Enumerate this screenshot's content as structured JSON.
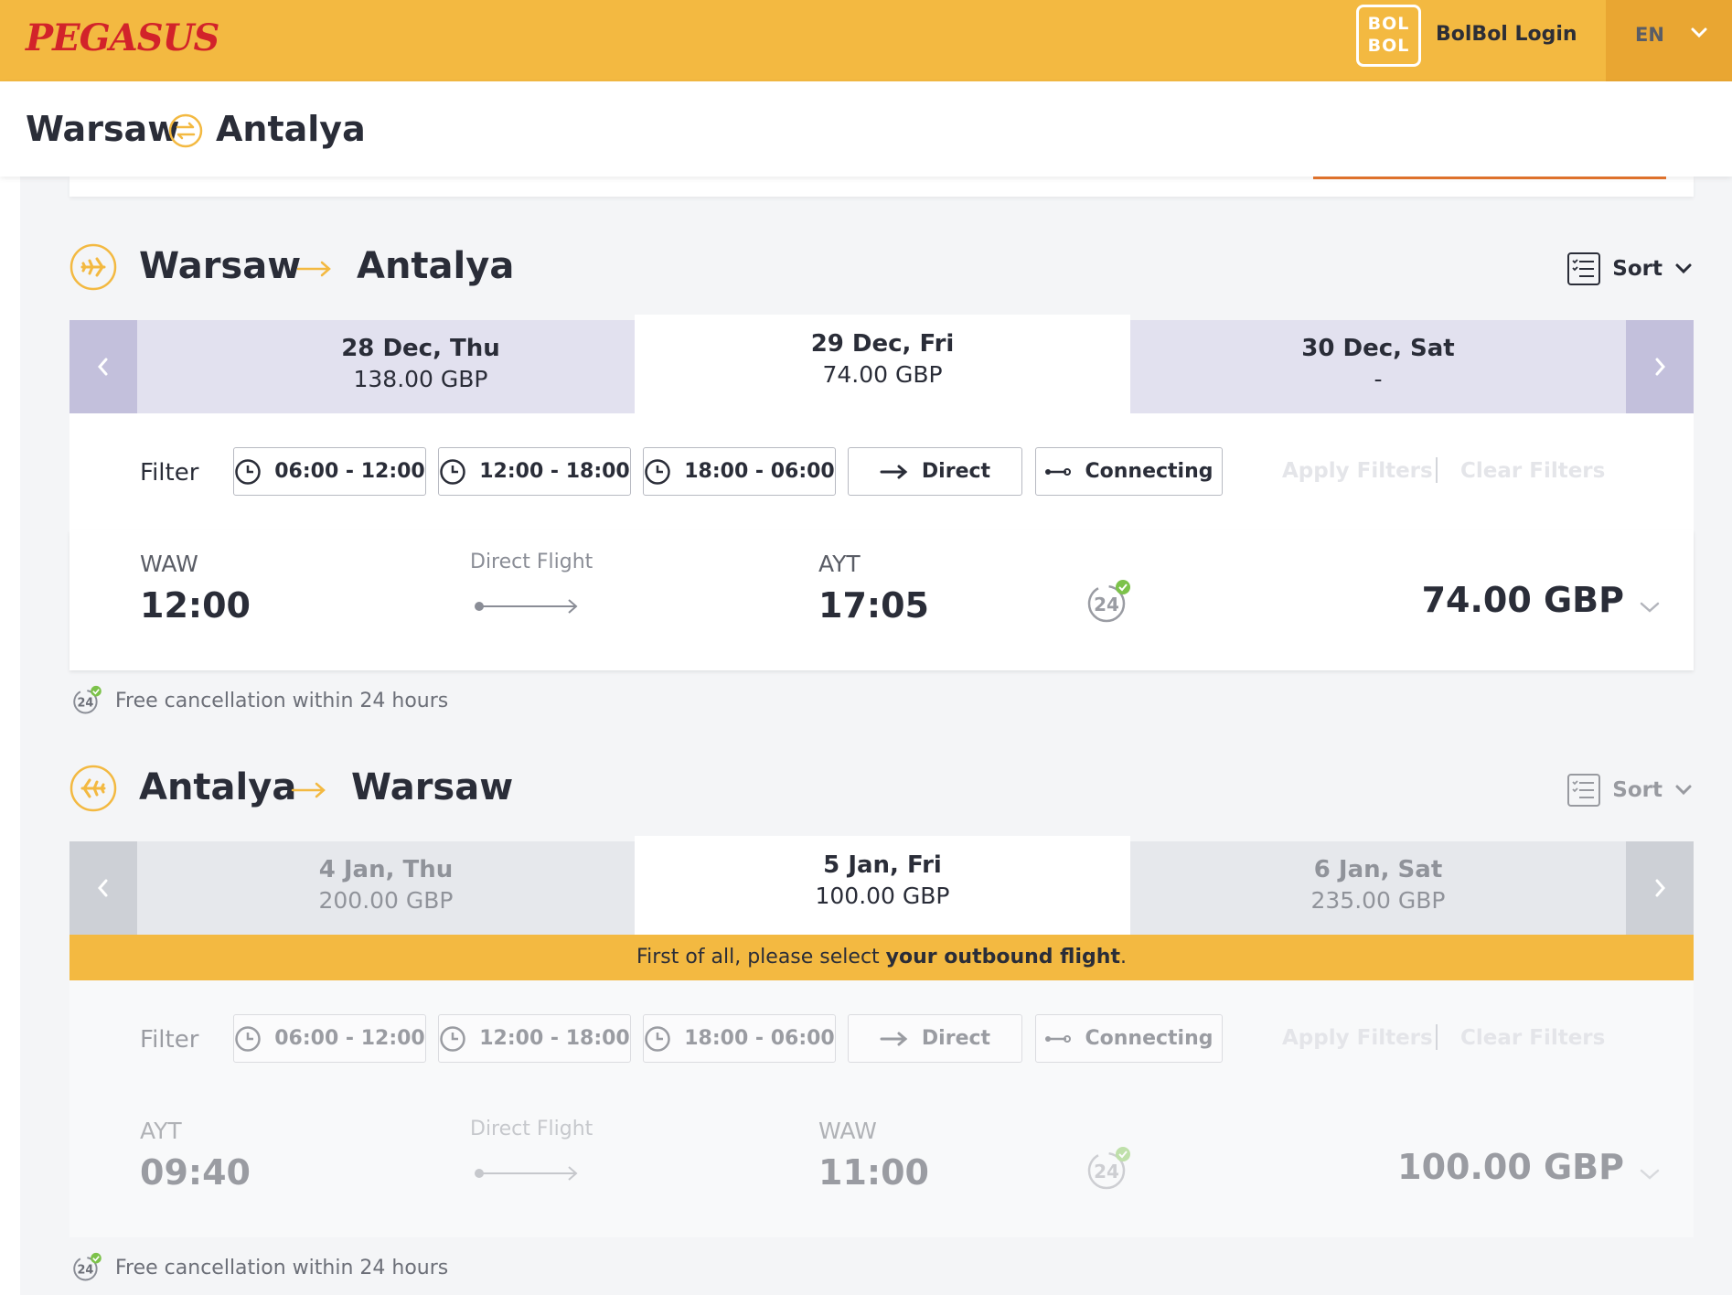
{
  "header": {
    "logo": "PEGASUS",
    "bolbol_badge_line1": "BOL",
    "bolbol_badge_line2": "BOL",
    "bolbol_login": "BolBol Login",
    "language": "EN"
  },
  "route": {
    "from": "Warsaw",
    "to": "Antalya"
  },
  "outbound": {
    "from": "Warsaw",
    "to": "Antalya",
    "sort_label": "Sort",
    "dates": [
      {
        "date": "28 Dec, Thu",
        "price": "138.00 GBP"
      },
      {
        "date": "29 Dec, Fri",
        "price": "74.00 GBP"
      },
      {
        "date": "30 Dec, Sat",
        "price": "-"
      }
    ],
    "filter_label": "Filter",
    "filters": [
      "06:00 - 12:00",
      "12:00 - 18:00",
      "18:00 - 06:00",
      "Direct",
      "Connecting"
    ],
    "apply_filters": "Apply Filters",
    "clear_filters": "Clear Filters",
    "flight": {
      "dep_code": "WAW",
      "dep_time": "12:00",
      "type": "Direct Flight",
      "arr_code": "AYT",
      "arr_time": "17:05",
      "price": "74.00 GBP"
    },
    "free_cancel": "Free cancellation within 24 hours"
  },
  "inbound": {
    "from": "Antalya",
    "to": "Warsaw",
    "sort_label": "Sort",
    "dates": [
      {
        "date": "4 Jan, Thu",
        "price": "200.00 GBP"
      },
      {
        "date": "5 Jan, Fri",
        "price": "100.00 GBP"
      },
      {
        "date": "6 Jan, Sat",
        "price": "235.00 GBP"
      }
    ],
    "notice_prefix": "First of all, please select ",
    "notice_bold": "your outbound flight",
    "notice_suffix": ".",
    "filter_label": "Filter",
    "filters": [
      "06:00 - 12:00",
      "12:00 - 18:00",
      "18:00 - 06:00",
      "Direct",
      "Connecting"
    ],
    "apply_filters": "Apply Filters",
    "clear_filters": "Clear Filters",
    "flight": {
      "dep_code": "AYT",
      "dep_time": "09:40",
      "type": "Direct Flight",
      "arr_code": "WAW",
      "arr_time": "11:00",
      "price": "100.00 GBP"
    },
    "free_cancel": "Free cancellation within 24 hours"
  },
  "colors": {
    "brand_yellow": "#f3b941",
    "brand_red": "#d2232a",
    "date_tab_outbound": "#e2e1ef",
    "date_nav_outbound": "#c3c0dc",
    "date_tab_inbound": "#e6e8ec",
    "date_nav_inbound": "#cdd0d6"
  },
  "icons": [
    "airplane-icon",
    "swap-icon",
    "sort-list-icon",
    "clock-icon",
    "arrow-right-icon",
    "connecting-icon",
    "free-cancel-24-icon",
    "chevron-down-icon",
    "chevron-left-icon",
    "chevron-right-icon"
  ]
}
